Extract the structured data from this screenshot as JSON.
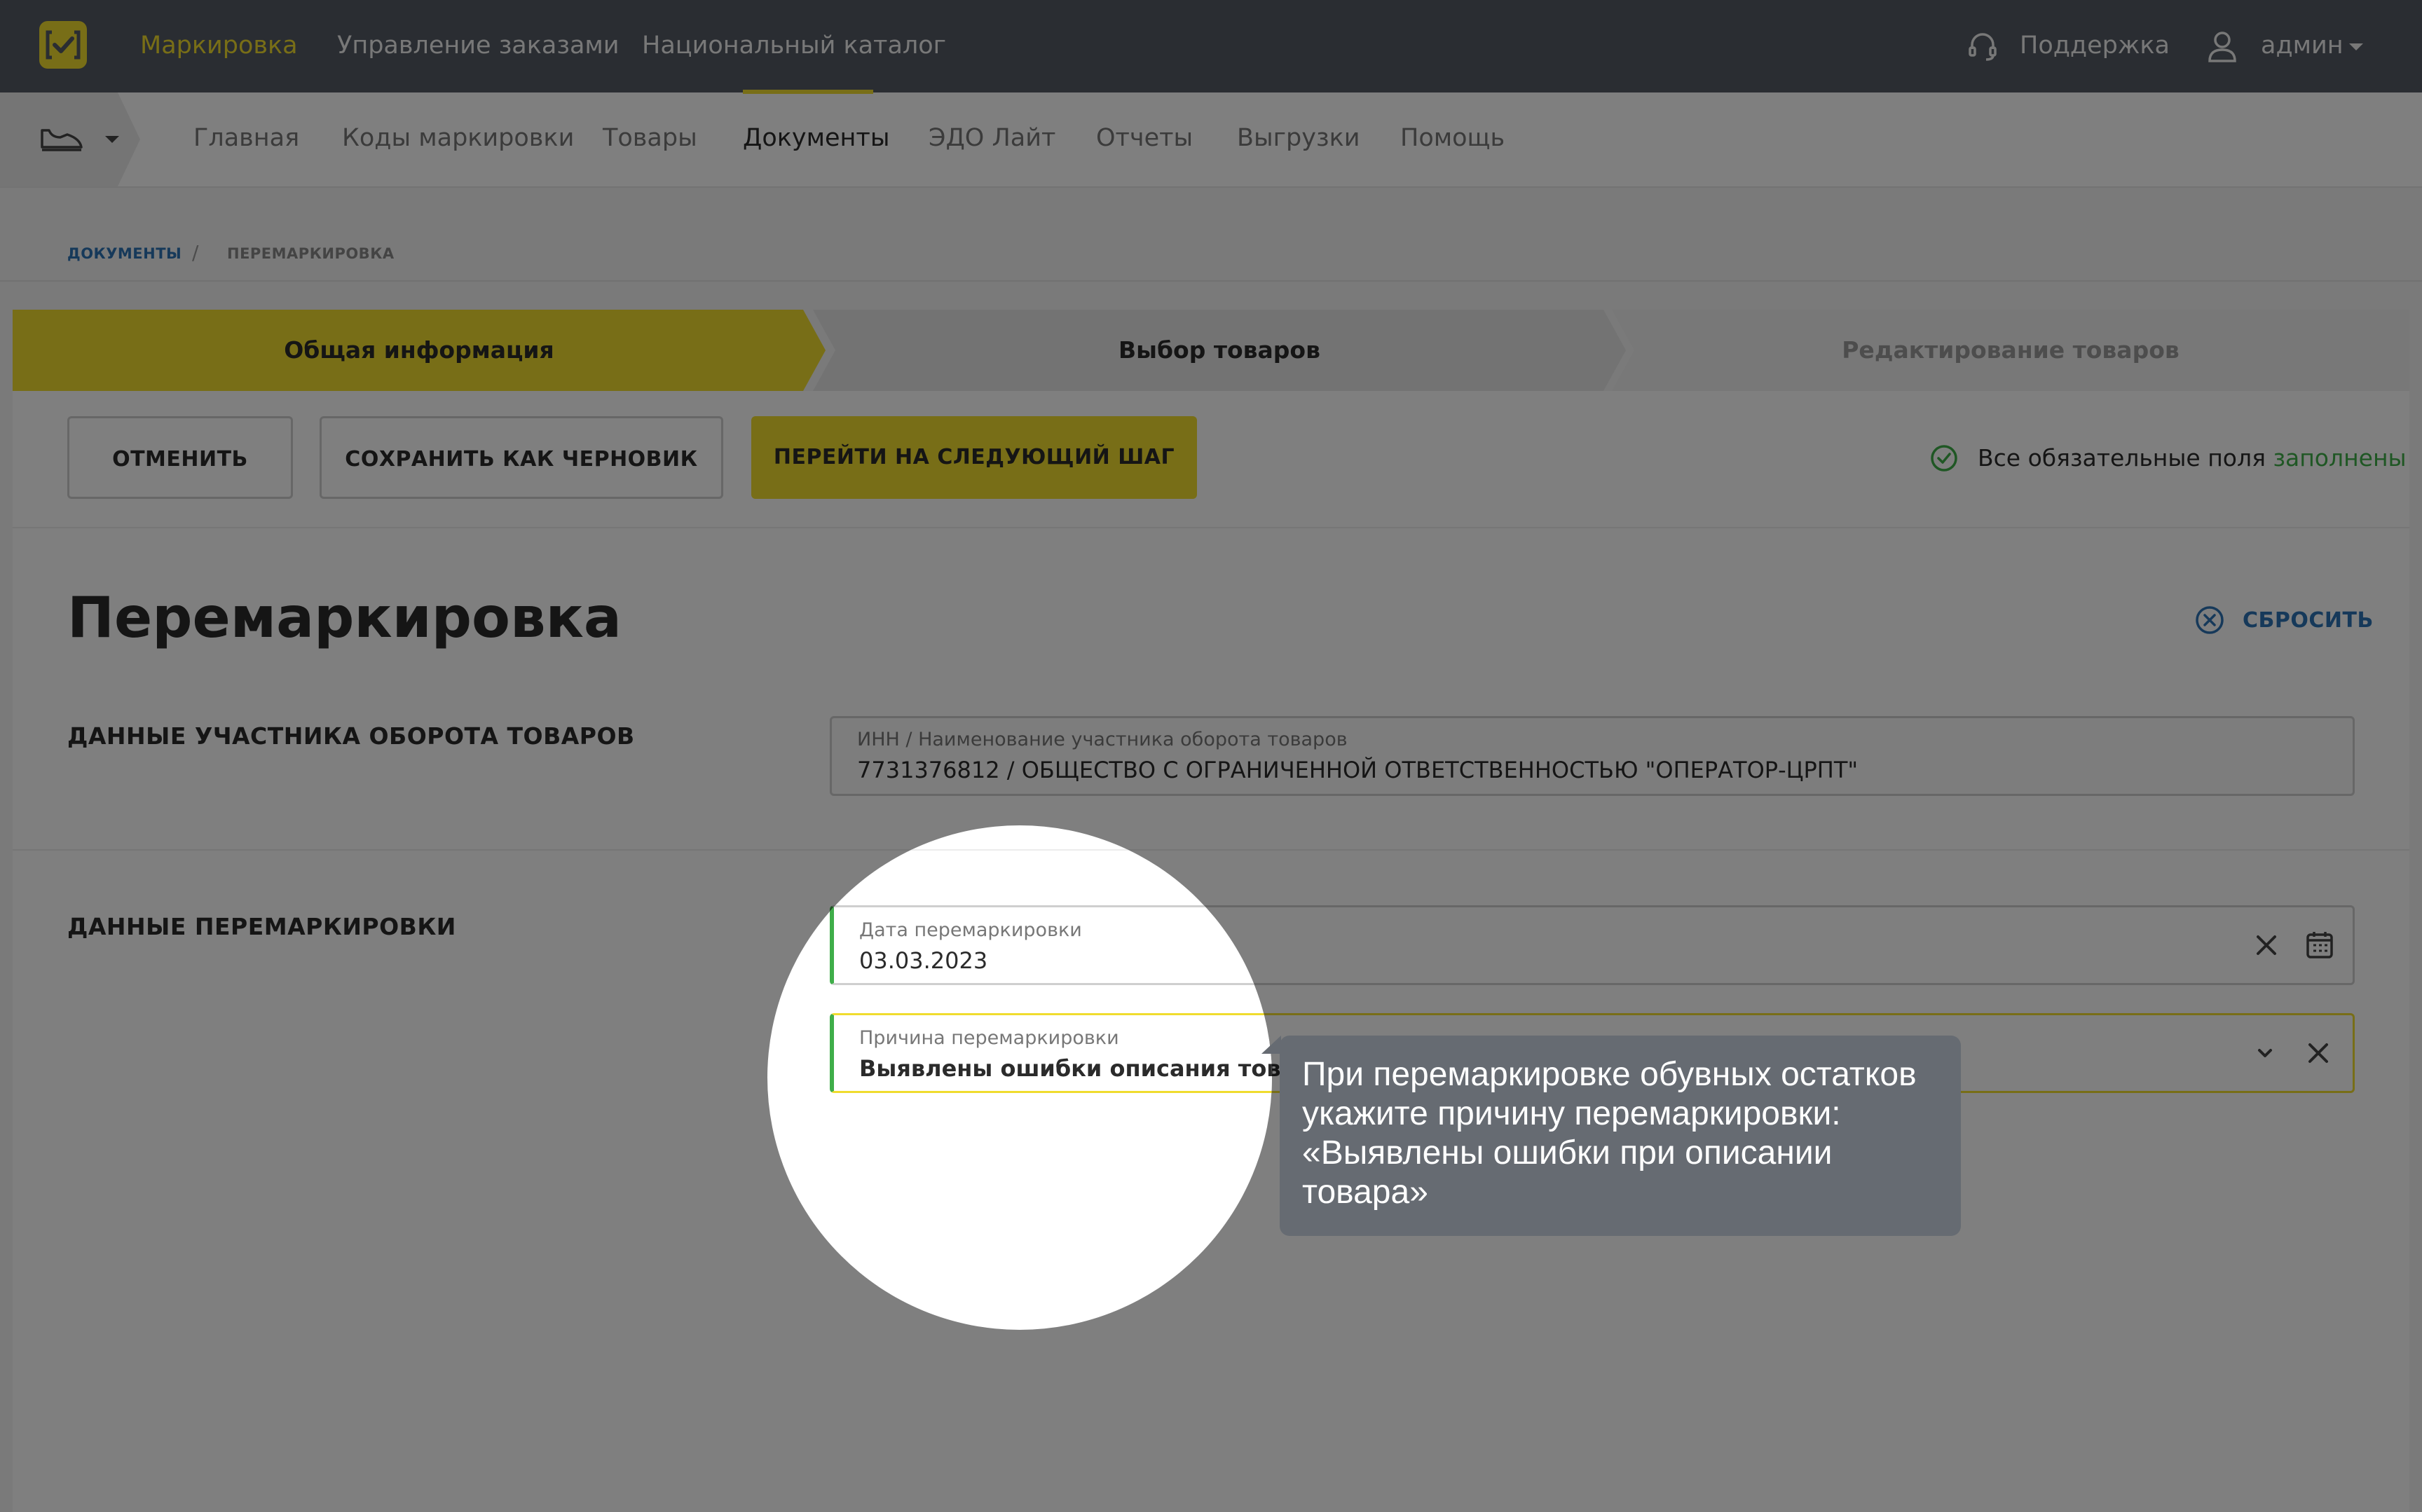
{
  "header": {
    "nav": [
      "Маркировка",
      "Управление заказами",
      "Национальный каталог"
    ],
    "support": "Поддержка",
    "user": "админ"
  },
  "subnav": {
    "items": [
      "Главная",
      "Коды маркировки",
      "Товары",
      "Документы",
      "ЭДО Лайт",
      "Отчеты",
      "Выгрузки",
      "Помощь"
    ],
    "active": "Документы"
  },
  "breadcrumb": {
    "root": "ДОКУМЕНТЫ",
    "separator": "/",
    "current": "ПЕРЕМАРКИРОВКА"
  },
  "steps": [
    "Общая информация",
    "Выбор товаров",
    "Редактирование товаров"
  ],
  "actions": {
    "cancel": "ОТМЕНИТЬ",
    "save_draft": "СОХРАНИТЬ КАК ЧЕРНОВИК",
    "next": "ПЕРЕЙТИ НА СЛЕДУЮЩИЙ ШАГ"
  },
  "status": {
    "text": "Все обязательные поля",
    "highlight": "заполнены"
  },
  "page": {
    "title": "Перемаркировка",
    "reset": "СБРОСИТЬ"
  },
  "participant": {
    "section": "ДАННЫЕ УЧАСТНИКА ОБОРОТА ТОВАРОВ",
    "label": "ИНН / Наименование участника оборота товаров",
    "value": "7731376812 / ОБЩЕСТВО С ОГРАНИЧЕННОЙ ОТВЕТСТВЕННОСТЬЮ \"ОПЕРАТОР-ЦРПТ\""
  },
  "remark": {
    "section": "ДАННЫЕ ПЕРЕМАРКИРОВКИ",
    "date_label": "Дата перемаркировки",
    "date_value": "03.03.2023",
    "reason_label": "Причина перемаркировки",
    "reason_value": "Выявлены ошибки описания товара"
  },
  "tooltip": {
    "text": "При перемаркировке обувных остатков укажите причину перемаркировки: «Выявлены ошибки при описании товара»"
  },
  "colors": {
    "accent": "#f0dc2e",
    "dark_bar": "#545b64",
    "link": "#2d73b5",
    "success": "#3fae49",
    "tooltip_bg": "#666b72"
  }
}
